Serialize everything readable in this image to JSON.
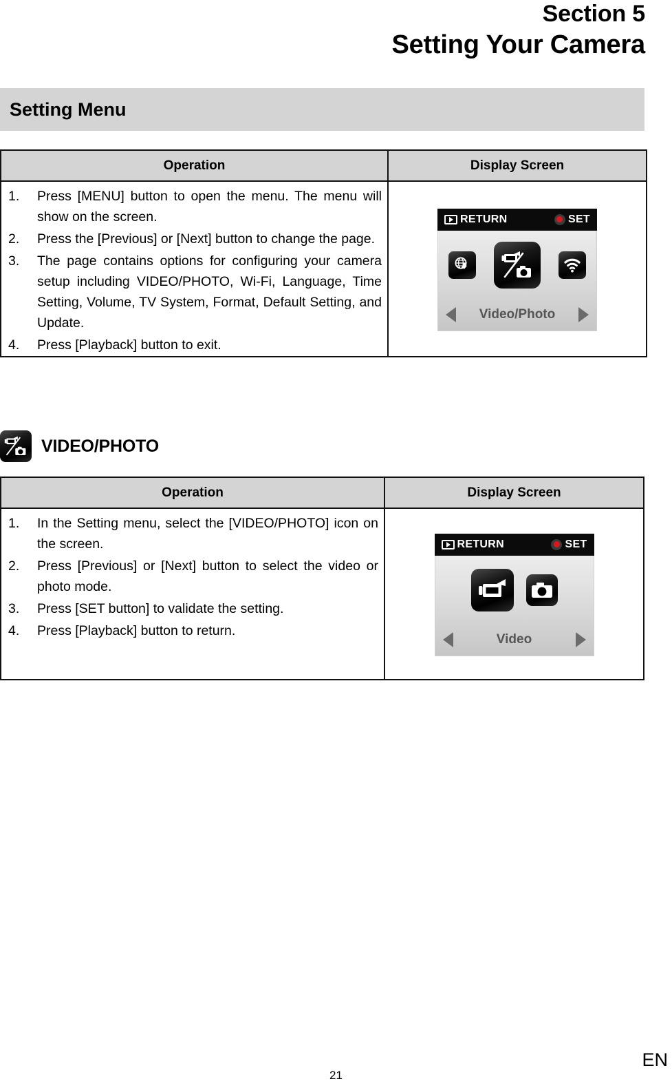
{
  "header": {
    "section_label": "Section 5",
    "section_title": "Setting Your Camera"
  },
  "section_band": {
    "title": "Setting Menu"
  },
  "table1": {
    "columns": {
      "operation": "Operation",
      "display_screen": "Display Screen"
    },
    "steps": [
      {
        "num": "1.",
        "text": "Press [MENU] button to open the menu. The menu will show on the screen."
      },
      {
        "num": "2.",
        "text": "Press the [Previous] or [Next] button to change the page."
      },
      {
        "num": "3.",
        "text": "The page contains options for configuring your camera setup including VIDEO/PHOTO, Wi-Fi, Language, Time Setting, Volume, TV System, Format, Default Setting, and Update."
      },
      {
        "num": "4.",
        "text": "Press [Playback] button to exit."
      }
    ],
    "screen": {
      "return_label": "RETURN",
      "set_label": "SET",
      "caption": "Video/Photo",
      "icons": [
        "update-globe-icon",
        "video-photo-icon",
        "wifi-icon"
      ],
      "selected_icon": "video-photo-icon",
      "prev_arrow": "left-triangle-icon",
      "next_arrow": "right-triangle-icon"
    }
  },
  "video_photo_heading": {
    "icon": "video-photo-icon",
    "title": "VIDEO/PHOTO"
  },
  "table2": {
    "columns": {
      "operation": "Operation",
      "display_screen": "Display Screen"
    },
    "steps": [
      {
        "num": "1.",
        "text": "In the Setting menu, select the [VIDEO/PHOTO] icon on the screen."
      },
      {
        "num": "2.",
        "text": "Press [Previous] or [Next] button to select the video or photo mode."
      },
      {
        "num": "3.",
        "text": "Press [SET button]  to validate the setting."
      },
      {
        "num": "4.",
        "text": "Press [Playback] button to return."
      }
    ],
    "screen": {
      "return_label": "RETURN",
      "set_label": "SET",
      "caption": "Video",
      "icons": [
        "video-camera-icon",
        "photo-camera-icon"
      ],
      "selected_icon": "video-camera-icon",
      "prev_arrow": "left-triangle-icon",
      "next_arrow": "right-triangle-icon"
    }
  },
  "footer": {
    "page_number": "21",
    "language_mark": "EN"
  },
  "colors": {
    "band_gray": "#d4d4d4",
    "border_black": "#111111",
    "lcd_bar_black": "#0b0b0b",
    "rec_red": "#d71920"
  }
}
